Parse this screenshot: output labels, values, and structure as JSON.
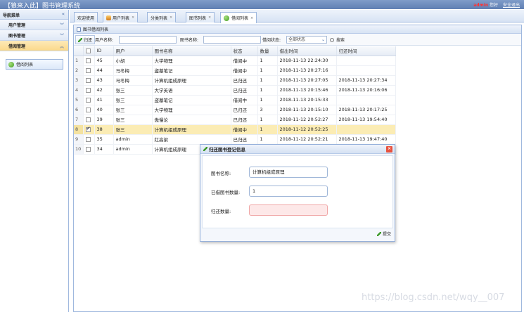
{
  "app": {
    "title": "【狼来入此】图书管理系统",
    "user": "admin",
    "greeting": "您好",
    "logout": "安全退出"
  },
  "sidebar": {
    "header": "导航菜单",
    "groups": [
      {
        "label": "用户管理"
      },
      {
        "label": "图书管理"
      },
      {
        "label": "借阅管理"
      }
    ],
    "item": "借阅列表"
  },
  "tabs": [
    {
      "label": "欢迎使用"
    },
    {
      "label": "用户列表"
    },
    {
      "label": "分类列表"
    },
    {
      "label": "图书列表"
    },
    {
      "label": "借阅列表"
    }
  ],
  "panel": {
    "title": "图书借阅列表",
    "return_button": "归还",
    "user_name_label": "用户名称:",
    "book_name_label": "图书名称:",
    "status_label": "借阅状态:",
    "status_value": "全部状态",
    "search_button": "搜索"
  },
  "table": {
    "headers": [
      "ID",
      "用户",
      "图书名称",
      "状态",
      "数量",
      "借出时间",
      "归还时间"
    ],
    "rows": [
      {
        "n": "1",
        "id": "45",
        "user": "小胡",
        "book": "大学物理",
        "status": "借阅中",
        "qty": "1",
        "out": "2018-11-13 22:24:30",
        "ret": ""
      },
      {
        "n": "2",
        "id": "44",
        "user": "马冬梅",
        "book": "盗墓笔记",
        "status": "借阅中",
        "qty": "1",
        "out": "2018-11-13 20:27:16",
        "ret": ""
      },
      {
        "n": "3",
        "id": "43",
        "user": "马冬梅",
        "book": "计算机组成原理",
        "status": "已归还",
        "qty": "1",
        "out": "2018-11-13 20:27:05",
        "ret": "2018-11-13 20:27:34"
      },
      {
        "n": "4",
        "id": "42",
        "user": "张三",
        "book": "大学英语",
        "status": "已归还",
        "qty": "1",
        "out": "2018-11-13 20:15:46",
        "ret": "2018-11-13 20:16:06"
      },
      {
        "n": "5",
        "id": "41",
        "user": "张三",
        "book": "盗墓笔记",
        "status": "借阅中",
        "qty": "1",
        "out": "2018-11-13 20:15:33",
        "ret": ""
      },
      {
        "n": "6",
        "id": "40",
        "user": "张三",
        "book": "大学物理",
        "status": "已归还",
        "qty": "3",
        "out": "2018-11-13 20:15:10",
        "ret": "2018-11-13 20:17:25"
      },
      {
        "n": "7",
        "id": "39",
        "user": "张三",
        "book": "傲慢论",
        "status": "已归还",
        "qty": "1",
        "out": "2018-11-12 20:52:27",
        "ret": "2018-11-13 19:54:40"
      },
      {
        "n": "8",
        "id": "38",
        "user": "张三",
        "book": "计算机组成原理",
        "status": "借阅中",
        "qty": "1",
        "out": "2018-11-12 20:52:25",
        "ret": ""
      },
      {
        "n": "9",
        "id": "35",
        "user": "admin",
        "book": "红高粱",
        "status": "已归还",
        "qty": "1",
        "out": "2018-11-12 20:52:21",
        "ret": "2018-11-13 19:47:40"
      },
      {
        "n": "10",
        "id": "34",
        "user": "admin",
        "book": "计算机组成原理",
        "status": "",
        "qty": "",
        "out": "",
        "ret": ""
      }
    ]
  },
  "dialog": {
    "title": "归还图书登记信息",
    "book_label": "图书名称:",
    "book_value": "计算机组成原理",
    "borrowed_label": "已借图书数量:",
    "borrowed_value": "1",
    "return_label": "归还数量:",
    "return_value": "",
    "submit": "提交"
  },
  "watermark": "https://blog.csdn.net/wqy__007"
}
